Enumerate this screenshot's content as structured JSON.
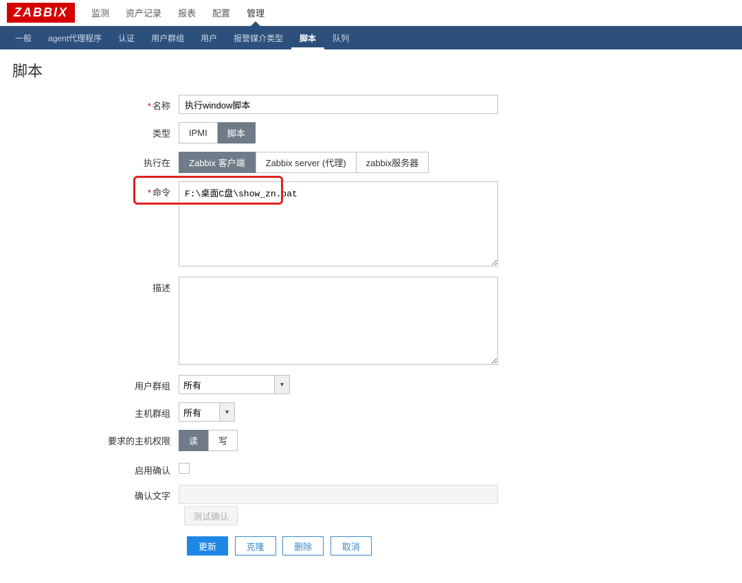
{
  "brand": "ZABBIX",
  "topnav": [
    {
      "label": "监测"
    },
    {
      "label": "资产记录"
    },
    {
      "label": "报表"
    },
    {
      "label": "配置"
    },
    {
      "label": "管理",
      "active": true
    }
  ],
  "subnav": [
    {
      "label": "一般"
    },
    {
      "label": "agent代理程序"
    },
    {
      "label": "认证"
    },
    {
      "label": "用户群组"
    },
    {
      "label": "用户"
    },
    {
      "label": "报警媒介类型"
    },
    {
      "label": "脚本",
      "active": true
    },
    {
      "label": "队列"
    }
  ],
  "page_title": "脚本",
  "labels": {
    "name": "名称",
    "type": "类型",
    "execute_on": "执行在",
    "command": "命令",
    "description": "描述",
    "user_group": "用户群组",
    "host_group": "主机群组",
    "host_perm": "要求的主机权限",
    "enable_confirm": "启用确认",
    "confirm_text": "确认文字"
  },
  "fields": {
    "name_value": "执行window脚本",
    "type_options": [
      "IPMI",
      "脚本"
    ],
    "type_selected": "脚本",
    "execute_on_options": [
      "Zabbix 客户端",
      "Zabbix server (代理)",
      "zabbix服务器"
    ],
    "execute_on_selected": "Zabbix 客户端",
    "command_value": "F:\\桌面C盘\\show_zn.bat",
    "description_value": "",
    "user_group_value": "所有",
    "host_group_value": "所有",
    "host_perm_options": [
      "读",
      "写"
    ],
    "host_perm_selected": "读",
    "confirm_text_value": "",
    "test_button": "测试确认"
  },
  "actions": {
    "update": "更新",
    "clone": "克隆",
    "delete": "删除",
    "cancel": "取消"
  }
}
